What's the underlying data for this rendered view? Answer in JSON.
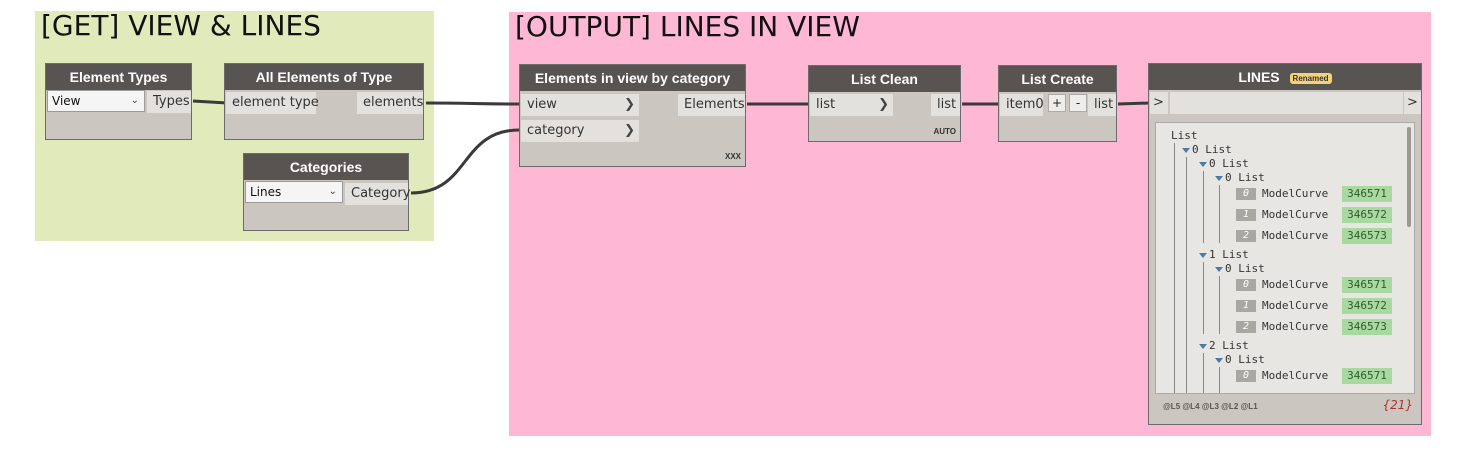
{
  "groups": {
    "get": {
      "title": "[GET] VIEW & LINES",
      "color": "#e1eabb"
    },
    "output": {
      "title": "[OUTPUT] LINES IN VIEW",
      "color": "#ffb8d3"
    }
  },
  "nodes": {
    "element_types": {
      "title": "Element Types",
      "dropdown_value": "View",
      "output": "Types"
    },
    "all_elements": {
      "title": "All Elements of Type",
      "input": "element type",
      "output": "elements"
    },
    "categories": {
      "title": "Categories",
      "dropdown_value": "Lines",
      "output": "Category"
    },
    "elements_in_view": {
      "title": "Elements in view by category",
      "inputs": [
        "view",
        "category"
      ],
      "output": "Elements",
      "footer": "XXX"
    },
    "list_clean": {
      "title": "List Clean",
      "input": "list",
      "output": "list",
      "footer": "AUTO"
    },
    "list_create": {
      "title": "List Create",
      "input": "item0",
      "plus": "+",
      "minus": "-",
      "output": "list"
    },
    "lines": {
      "title": "LINES",
      "badge": "Renamed",
      "in_port": ">",
      "out_port": ">",
      "levels": [
        "@L5",
        "@L4",
        "@L3",
        "@L2",
        "@L1"
      ],
      "count": "{21}",
      "tree": {
        "root": "List",
        "l0": "0 List",
        "groups": [
          {
            "label": "0 List",
            "sub": "0 List",
            "items": [
              {
                "idx": "0",
                "type": "ModelCurve",
                "id": "346571"
              },
              {
                "idx": "1",
                "type": "ModelCurve",
                "id": "346572"
              },
              {
                "idx": "2",
                "type": "ModelCurve",
                "id": "346573"
              }
            ]
          },
          {
            "label": "1 List",
            "sub": "0 List",
            "items": [
              {
                "idx": "0",
                "type": "ModelCurve",
                "id": "346571"
              },
              {
                "idx": "1",
                "type": "ModelCurve",
                "id": "346572"
              },
              {
                "idx": "2",
                "type": "ModelCurve",
                "id": "346573"
              }
            ]
          },
          {
            "label": "2 List",
            "sub": "0 List",
            "items": [
              {
                "idx": "0",
                "type": "ModelCurve",
                "id": "346571"
              }
            ]
          }
        ]
      }
    }
  }
}
